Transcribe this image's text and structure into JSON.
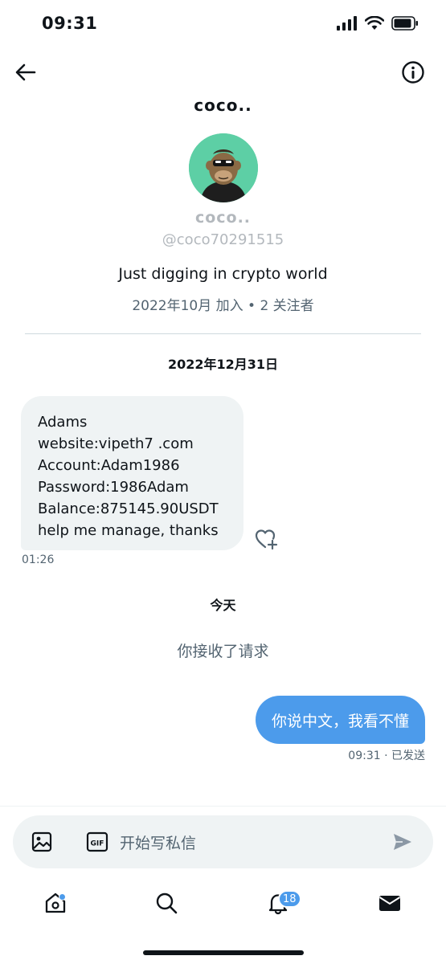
{
  "status_bar": {
    "time": "09:31",
    "icons": [
      "signal-icon",
      "wifi-icon",
      "battery-icon"
    ]
  },
  "nav": {
    "title": "coco..",
    "back_icon": "arrow-left-icon",
    "info_icon": "info-icon"
  },
  "profile": {
    "name": "coco..",
    "handle": "@coco70291515",
    "bio": "Just digging in crypto world",
    "meta": "2022年10月 加入 • 2 关注者",
    "avatar_bg": "#5dcfa5"
  },
  "conversation": {
    "date_label": "2022年12月31日",
    "incoming": {
      "lines": [
        "Adams",
        "website:vipeth7 .com",
        "Account:Adam1986",
        "Password:1986Adam",
        "Balance:875145.90USDT",
        "help me manage, thanks"
      ],
      "time": "01:26",
      "like_icon": "heart-plus-icon"
    },
    "today_label": "今天",
    "accepted_text": "你接收了请求",
    "outgoing": {
      "text": "你说中文，我看不懂",
      "time": "09:31 · 已发送"
    }
  },
  "composer": {
    "placeholder": "开始写私信",
    "image_icon": "image-icon",
    "gif_icon": "gif-icon",
    "send_icon": "send-icon"
  },
  "tab_bar": {
    "tabs": [
      "home-icon",
      "search-icon",
      "bell-icon",
      "mail-icon"
    ],
    "notification_count": "18"
  },
  "colors": {
    "accent": "#4c9beb",
    "bubble_incoming": "#eff3f4",
    "secondary_text": "#536471"
  }
}
